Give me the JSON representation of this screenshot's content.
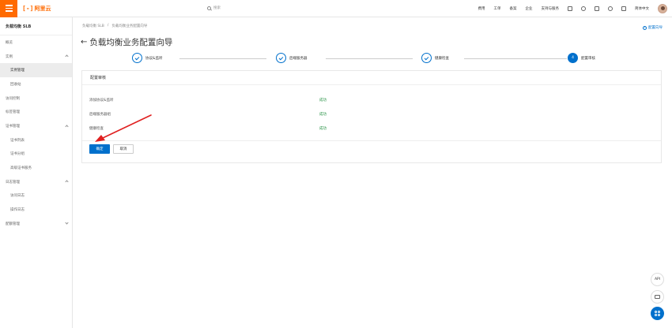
{
  "header": {
    "logo_mark": "[-]",
    "logo_text": "阿里云",
    "search_placeholder": "搜索",
    "links": [
      "费用",
      "工单",
      "备案",
      "企业",
      "支持与服务"
    ],
    "language": "简体中文"
  },
  "sidebar": {
    "title": "负载均衡 SLB",
    "items": [
      {
        "label": "概览",
        "type": "item"
      },
      {
        "label": "实例",
        "type": "group-open"
      },
      {
        "label": "实例管理",
        "type": "child",
        "active": true
      },
      {
        "label": "回收站",
        "type": "child"
      },
      {
        "label": "访问控制",
        "type": "item"
      },
      {
        "label": "标签管理",
        "type": "item"
      },
      {
        "label": "证书管理",
        "type": "group-open"
      },
      {
        "label": "证书列表",
        "type": "child"
      },
      {
        "label": "证书分组",
        "type": "child"
      },
      {
        "label": "高级证书服务",
        "type": "child"
      },
      {
        "label": "日志管理",
        "type": "group-open"
      },
      {
        "label": "访问日志",
        "type": "child"
      },
      {
        "label": "操作日志",
        "type": "child"
      },
      {
        "label": "配额管理",
        "type": "group-closed"
      }
    ]
  },
  "breadcrumb": [
    "负载均衡 SLB",
    "/",
    "负载均衡业务配置向导"
  ],
  "help_link": "配置向导",
  "page_title": "负载均衡业务配置向导",
  "steps": [
    {
      "label": "协议&监听",
      "state": "done",
      "number": ""
    },
    {
      "label": "后端服务器",
      "state": "done",
      "number": ""
    },
    {
      "label": "健康检查",
      "state": "done",
      "number": ""
    },
    {
      "label": "配置审核",
      "state": "current",
      "number": "4"
    }
  ],
  "card": {
    "title": "配置审核",
    "rows": [
      {
        "label": "添加协议&监听",
        "status": "成功"
      },
      {
        "label": "后端服务器组",
        "status": "成功"
      },
      {
        "label": "健康检查",
        "status": "成功"
      }
    ],
    "primary_button": "确定",
    "secondary_button": "取消"
  },
  "float_tools": {
    "api_label": "API"
  },
  "colors": {
    "brand": "#ff6a00",
    "primary": "#0070cc",
    "success": "#1e8e3e",
    "annotation": "#e02020"
  }
}
